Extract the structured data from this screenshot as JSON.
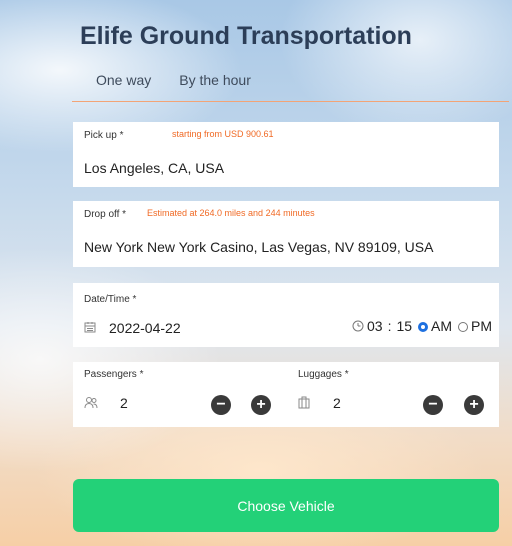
{
  "title": "Elife Ground Transportation",
  "tabs": [
    {
      "label": "One way"
    },
    {
      "label": "By the hour"
    }
  ],
  "pickup": {
    "label": "Pick up *",
    "hint": "starting from USD 900.61",
    "value": "Los Angeles, CA, USA"
  },
  "dropoff": {
    "label": "Drop off *",
    "hint": "Estimated at 264.0 miles and 244 minutes",
    "value": "New York New York Casino, Las Vegas, NV 89109, USA"
  },
  "datetime": {
    "label": "Date/Time *",
    "date": "2022-04-22",
    "hour": "03",
    "separator": ":",
    "minute": "15",
    "am": "AM",
    "pm": "PM",
    "selected": "AM"
  },
  "passengers": {
    "label": "Passengers *",
    "value": "2"
  },
  "luggages": {
    "label": "Luggages *",
    "value": "2"
  },
  "cta": {
    "label": "Choose Vehicle"
  },
  "colors": {
    "accent": "#23d178",
    "hint": "#f06a25",
    "tab_line": "#f3a476",
    "title": "#2c3e58"
  },
  "icons": {
    "calendar": "calendar-icon",
    "clock": "clock-icon",
    "passenger": "passenger-icon",
    "luggage": "luggage-icon",
    "minus": "minus-icon",
    "plus": "plus-icon"
  }
}
